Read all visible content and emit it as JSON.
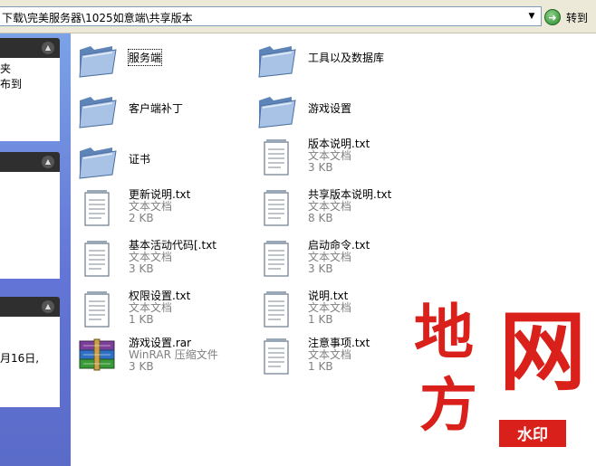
{
  "address_bar": {
    "path": "下载\\完美服务器\\1025如意端\\共享版本",
    "go_label": "转到"
  },
  "task_pane": {
    "panel1_lines": [
      "夹",
      "布到"
    ],
    "panel3_lines": [
      "月16日,"
    ]
  },
  "folders": [
    {
      "name": "服务端"
    },
    {
      "name": "工具以及数据库"
    },
    {
      "name": "客户端补丁"
    },
    {
      "name": "游戏设置"
    },
    {
      "name": "证书"
    }
  ],
  "files": [
    {
      "name": "版本说明.txt",
      "type": "文本文档",
      "size": "3 KB",
      "icon": "text-document-icon"
    },
    {
      "name": "更新说明.txt",
      "type": "文本文档",
      "size": "2 KB",
      "icon": "text-document-icon"
    },
    {
      "name": "共享版本说明.txt",
      "type": "文本文档",
      "size": "8 KB",
      "icon": "text-document-icon"
    },
    {
      "name": "基本活动代码[.txt",
      "type": "文本文档",
      "size": "3 KB",
      "icon": "text-document-icon"
    },
    {
      "name": "启动命令.txt",
      "type": "文本文档",
      "size": "3 KB",
      "icon": "text-document-icon"
    },
    {
      "name": "权限设置.txt",
      "type": "文本文档",
      "size": "1 KB",
      "icon": "text-document-icon"
    },
    {
      "name": "说明.txt",
      "type": "文本文档",
      "size": "1 KB",
      "icon": "text-document-icon"
    },
    {
      "name": "游戏设置.rar",
      "type": "WinRAR 压缩文件",
      "size": "3 KB",
      "icon": "winrar-archive-icon"
    },
    {
      "name": "注意事项.txt",
      "type": "文本文档",
      "size": "1 KB",
      "icon": "text-document-icon"
    }
  ],
  "watermark": {
    "chars": [
      "地",
      "网",
      "方"
    ],
    "badge": "水印",
    "color": "#d9201a"
  },
  "colors": {
    "taskpane_top": "#7ba2e7",
    "taskpane_bottom": "#5a6bc8",
    "panel_header": "#2f2f2f"
  }
}
